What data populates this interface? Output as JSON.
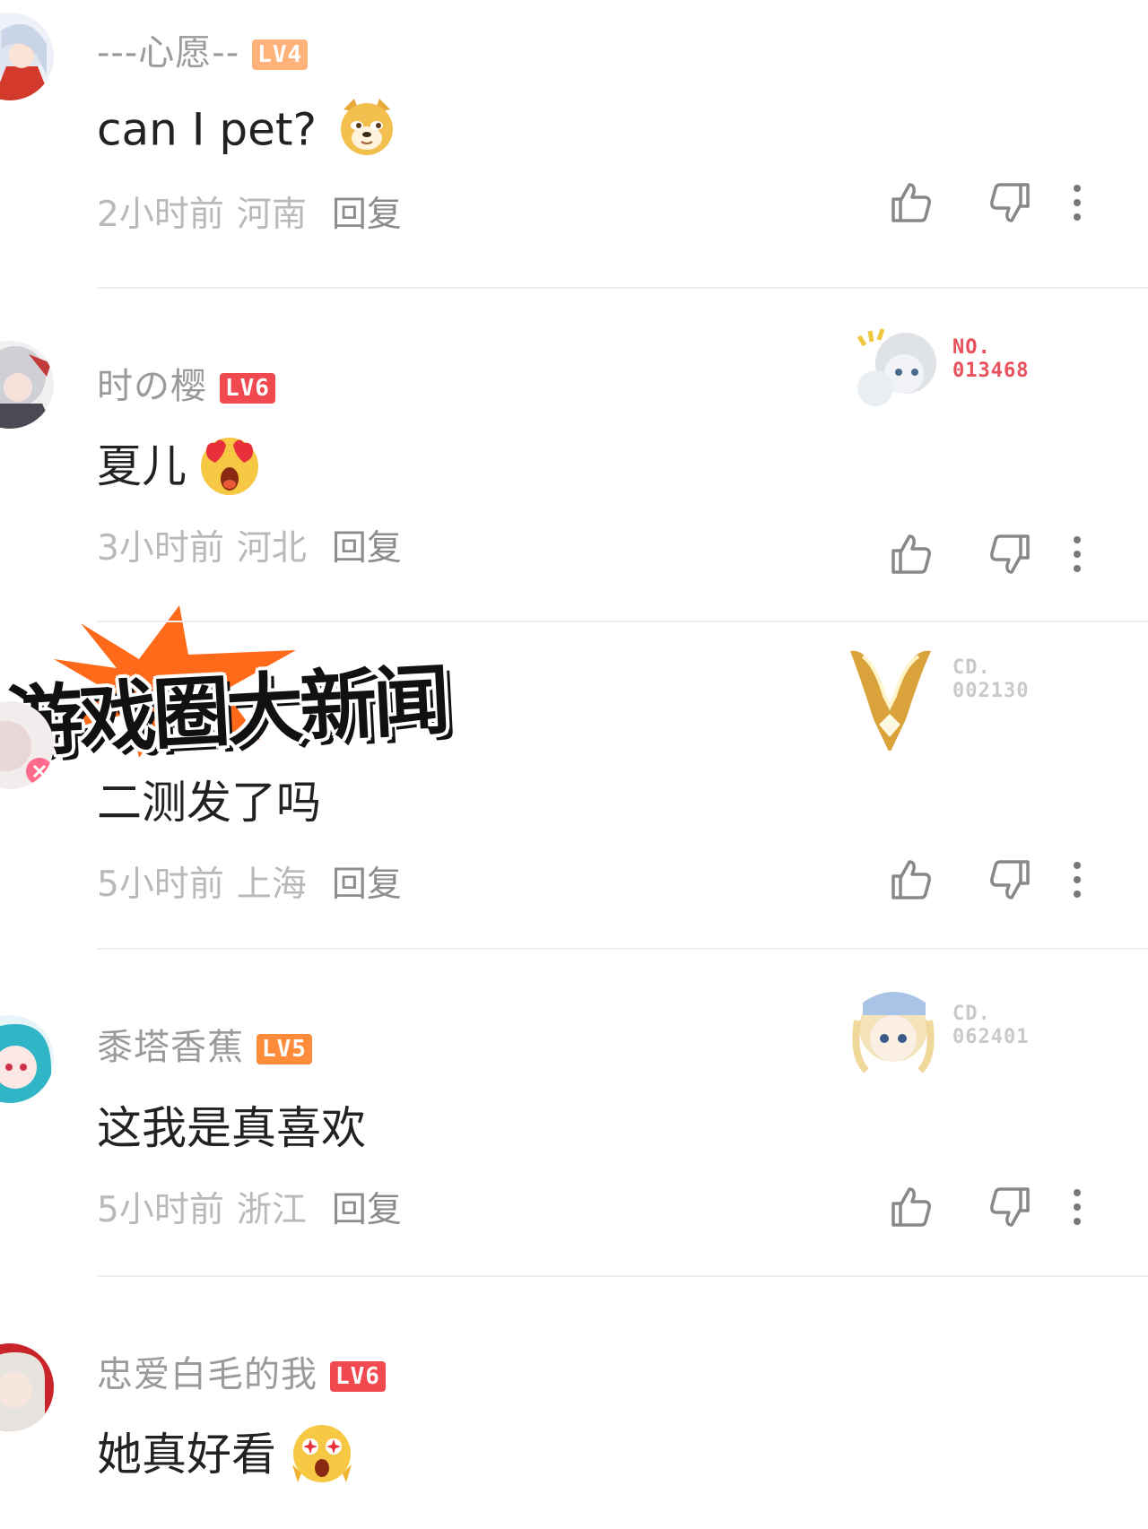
{
  "overlay_title": "游戏圈大新闻",
  "reply_label": "回复",
  "comments": [
    {
      "username": "---心愿--",
      "level": "LV4",
      "text": "can I pet?",
      "emoji": "doge-emoji",
      "time": "2小时前",
      "region": "河南"
    },
    {
      "username": "时の樱",
      "level": "LV6",
      "text": "夏儿",
      "emoji": "heart-eyes-emoji",
      "time": "3小时前",
      "region": "河北",
      "badge": {
        "label": "NO.",
        "number": "013468",
        "color": "#e8505b"
      }
    },
    {
      "username": "",
      "level": "",
      "text": "二测发了吗",
      "time": "5小时前",
      "region": "上海",
      "badge": {
        "label": "CD.",
        "number": "002130",
        "color": "#c9c9c9"
      }
    },
    {
      "username": "黍塔香蕉",
      "level": "LV5",
      "text": "这我是真喜欢",
      "time": "5小时前",
      "region": "浙江",
      "badge": {
        "label": "CD.",
        "number": "062401",
        "color": "#c9c9c9"
      }
    },
    {
      "username": "忠爱白毛的我",
      "level": "LV6",
      "text": "她真好看",
      "emoji": "starstruck-emoji",
      "time": "",
      "region": ""
    }
  ],
  "colors": {
    "lv4": "#ffb27a",
    "lv5": "#ff8c3a",
    "lv6": "#f0494f",
    "accent": "#ff6a1a"
  }
}
